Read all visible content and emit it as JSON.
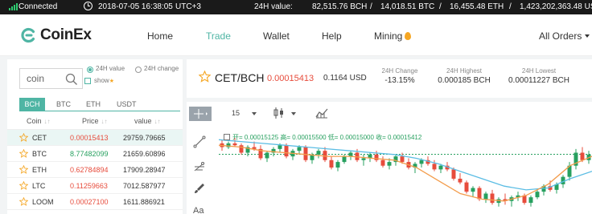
{
  "status_bar": {
    "connection": "Connected",
    "datetime": "2018-07-05 16:38:05",
    "timezone": "UTC+3",
    "volume_label": "24H value:",
    "volume_usd": "82,515.76 BCH",
    "volume_btc": "14,018.51 BTC",
    "volume_eth": "16,455.48 ETH",
    "volume_more": "1,423,202,363.48 USD",
    "separator": "/"
  },
  "nav": {
    "brand": "CoinEx",
    "items": [
      "Home",
      "Trade",
      "Wallet",
      "Help",
      "Mining",
      "All Orders"
    ],
    "active": "Trade"
  },
  "market": {
    "search_value": "coin",
    "radio_options": [
      "24H value",
      "24H change"
    ],
    "show_label": "show",
    "tabs": [
      "BCH",
      "BTC",
      "ETH",
      "USDT"
    ],
    "headers": [
      "Coin",
      "Price",
      "value"
    ],
    "sort_glyph": "↓↑",
    "rows": [
      {
        "coin": "CET",
        "price": "0.00015413",
        "value": "29759.79665",
        "trend": "down"
      },
      {
        "coin": "BTC",
        "price": "8.77482099",
        "value": "21659.60896",
        "trend": "up"
      },
      {
        "coin": "ETH",
        "price": "0.62784894",
        "value": "17909.28947",
        "trend": "down"
      },
      {
        "coin": "LTC",
        "price": "0.11259663",
        "value": "7012.587977",
        "trend": "down"
      },
      {
        "coin": "LOOM",
        "price": "0.00027100",
        "value": "1611.886921",
        "trend": "down"
      }
    ]
  },
  "ticker": {
    "pair": "CET/BCH",
    "price": "0.00015413",
    "price_usd": "0.1164 USD",
    "change_label": "24H Change",
    "change": "-13.15%",
    "high_label": "24H Highest",
    "high": "0.000185 BCH",
    "low_label": "24H Lowest",
    "low": "0.00011227 BCH"
  },
  "chart_toolbar": {
    "interval": "15"
  },
  "chart_data": {
    "type": "candlestick",
    "interval": "15",
    "legend": "开= 0.00015125 高= 0.00015500 低= 0.00015000 收= 0.00015412",
    "current_price": 0.00015413,
    "ohlc": [
      [
        0.00016,
        0.000162,
        0.000156,
        0.000158
      ],
      [
        0.000158,
        0.000161,
        0.000157,
        0.00016
      ],
      [
        0.00016,
        0.000163,
        0.000158,
        0.000159
      ],
      [
        0.000159,
        0.00016,
        0.000154,
        0.000155
      ],
      [
        0.000155,
        0.000159,
        0.000153,
        0.000158
      ],
      [
        0.000158,
        0.000161,
        0.000156,
        0.000157
      ],
      [
        0.000157,
        0.000159,
        0.000151,
        0.000152
      ],
      [
        0.000152,
        0.000156,
        0.00015,
        0.000155
      ],
      [
        0.000155,
        0.000158,
        0.000153,
        0.000157
      ],
      [
        0.000157,
        0.00016,
        0.000155,
        0.000159
      ],
      [
        0.000159,
        0.00016,
        0.000152,
        0.000153
      ],
      [
        0.000153,
        0.000157,
        0.000151,
        0.000156
      ],
      [
        0.000156,
        0.000159,
        0.000154,
        0.000158
      ],
      [
        0.000158,
        0.000159,
        0.00015,
        0.000151
      ],
      [
        0.000151,
        0.000155,
        0.000149,
        0.000154
      ],
      [
        0.000154,
        0.000157,
        0.000152,
        0.000156
      ],
      [
        0.000156,
        0.000158,
        0.00015,
        0.000151
      ],
      [
        0.000151,
        0.000153,
        0.000146,
        0.000147
      ],
      [
        0.000147,
        0.000151,
        0.000145,
        0.00015
      ],
      [
        0.00015,
        0.000154,
        0.000149,
        0.000153
      ],
      [
        0.000153,
        0.000156,
        0.000151,
        0.000155
      ],
      [
        0.000155,
        0.000157,
        0.00015,
        0.000151
      ],
      [
        0.000151,
        0.000154,
        0.000148,
        0.000152
      ],
      [
        0.000152,
        0.000155,
        0.00015,
        0.000154
      ],
      [
        0.000154,
        0.000156,
        0.00015,
        0.000151
      ],
      [
        0.000151,
        0.000153,
        0.000147,
        0.000148
      ],
      [
        0.000148,
        0.000152,
        0.000146,
        0.00015
      ],
      [
        0.00015,
        0.000154,
        0.000148,
        0.000153
      ],
      [
        0.000153,
        0.000155,
        0.000149,
        0.00015
      ],
      [
        0.00015,
        0.000152,
        0.000146,
        0.000147
      ],
      [
        0.000147,
        0.00015,
        0.000144,
        0.000149
      ],
      [
        0.000149,
        0.000152,
        0.000147,
        0.000151
      ],
      [
        0.000151,
        0.000153,
        0.000148,
        0.000149
      ],
      [
        0.000149,
        0.000151,
        0.000145,
        0.000146
      ],
      [
        0.000146,
        0.000149,
        0.000144,
        0.000148
      ],
      [
        0.000148,
        0.00015,
        0.000145,
        0.000146
      ],
      [
        0.000146,
        0.000147,
        0.00014,
        0.000141
      ],
      [
        0.000141,
        0.000144,
        0.000138,
        0.000139
      ],
      [
        0.000139,
        0.00014,
        0.000133,
        0.000134
      ],
      [
        0.000134,
        0.000137,
        0.000131,
        0.000136
      ],
      [
        0.000136,
        0.000137,
        0.000129,
        0.00013
      ],
      [
        0.00013,
        0.000134,
        0.000128,
        0.000133
      ],
      [
        0.000133,
        0.000135,
        0.000127,
        0.000128
      ],
      [
        0.000128,
        0.000131,
        0.000126,
        0.00013
      ],
      [
        0.00013,
        0.000133,
        0.000127,
        0.000129
      ],
      [
        0.000129,
        0.000132,
        0.000126,
        0.000131
      ],
      [
        0.000131,
        0.000134,
        0.000129,
        0.000132
      ],
      [
        0.000132,
        0.000133,
        0.000127,
        0.000128
      ],
      [
        0.000128,
        0.000132,
        0.000126,
        0.000131
      ],
      [
        0.000131,
        0.000135,
        0.00013,
        0.000134
      ],
      [
        0.000134,
        0.000138,
        0.000132,
        0.000137
      ],
      [
        0.000137,
        0.00014,
        0.000134,
        0.000135
      ],
      [
        0.000135,
        0.000139,
        0.000133,
        0.000138
      ],
      [
        0.000138,
        0.000143,
        0.000136,
        0.000142
      ],
      [
        0.000142,
        0.00015,
        0.00014,
        0.000148
      ],
      [
        0.000148,
        0.000157,
        0.000146,
        0.000155
      ],
      [
        0.000155,
        0.000158,
        0.00015,
        0.000151
      ],
      [
        0.000151,
        0.000156,
        0.000149,
        0.000154
      ]
    ],
    "ma_short": [
      0.000159,
      0.000158,
      0.000156,
      0.000155,
      0.000154,
      0.000153,
      0.000153,
      0.000152,
      0.000151,
      0.000147,
      0.00014,
      0.000133,
      0.00013,
      0.000129,
      0.000132,
      0.000138,
      0.000148,
      0.000153
    ],
    "ma_long": [
      0.000162,
      0.000161,
      0.00016,
      0.000159,
      0.000158,
      0.000157,
      0.000156,
      0.000155,
      0.000154,
      0.000152,
      0.000149,
      0.000145,
      0.000141,
      0.000137,
      0.000135,
      0.000136,
      0.000141,
      0.000145
    ],
    "ylim": [
      0.000122,
      0.000166
    ],
    "colors": {
      "up": "#27a05f",
      "down": "#e74c3c",
      "ma_short": "#f39c4b",
      "ma_long": "#5bbde4",
      "price_line": "#27a05f"
    }
  }
}
